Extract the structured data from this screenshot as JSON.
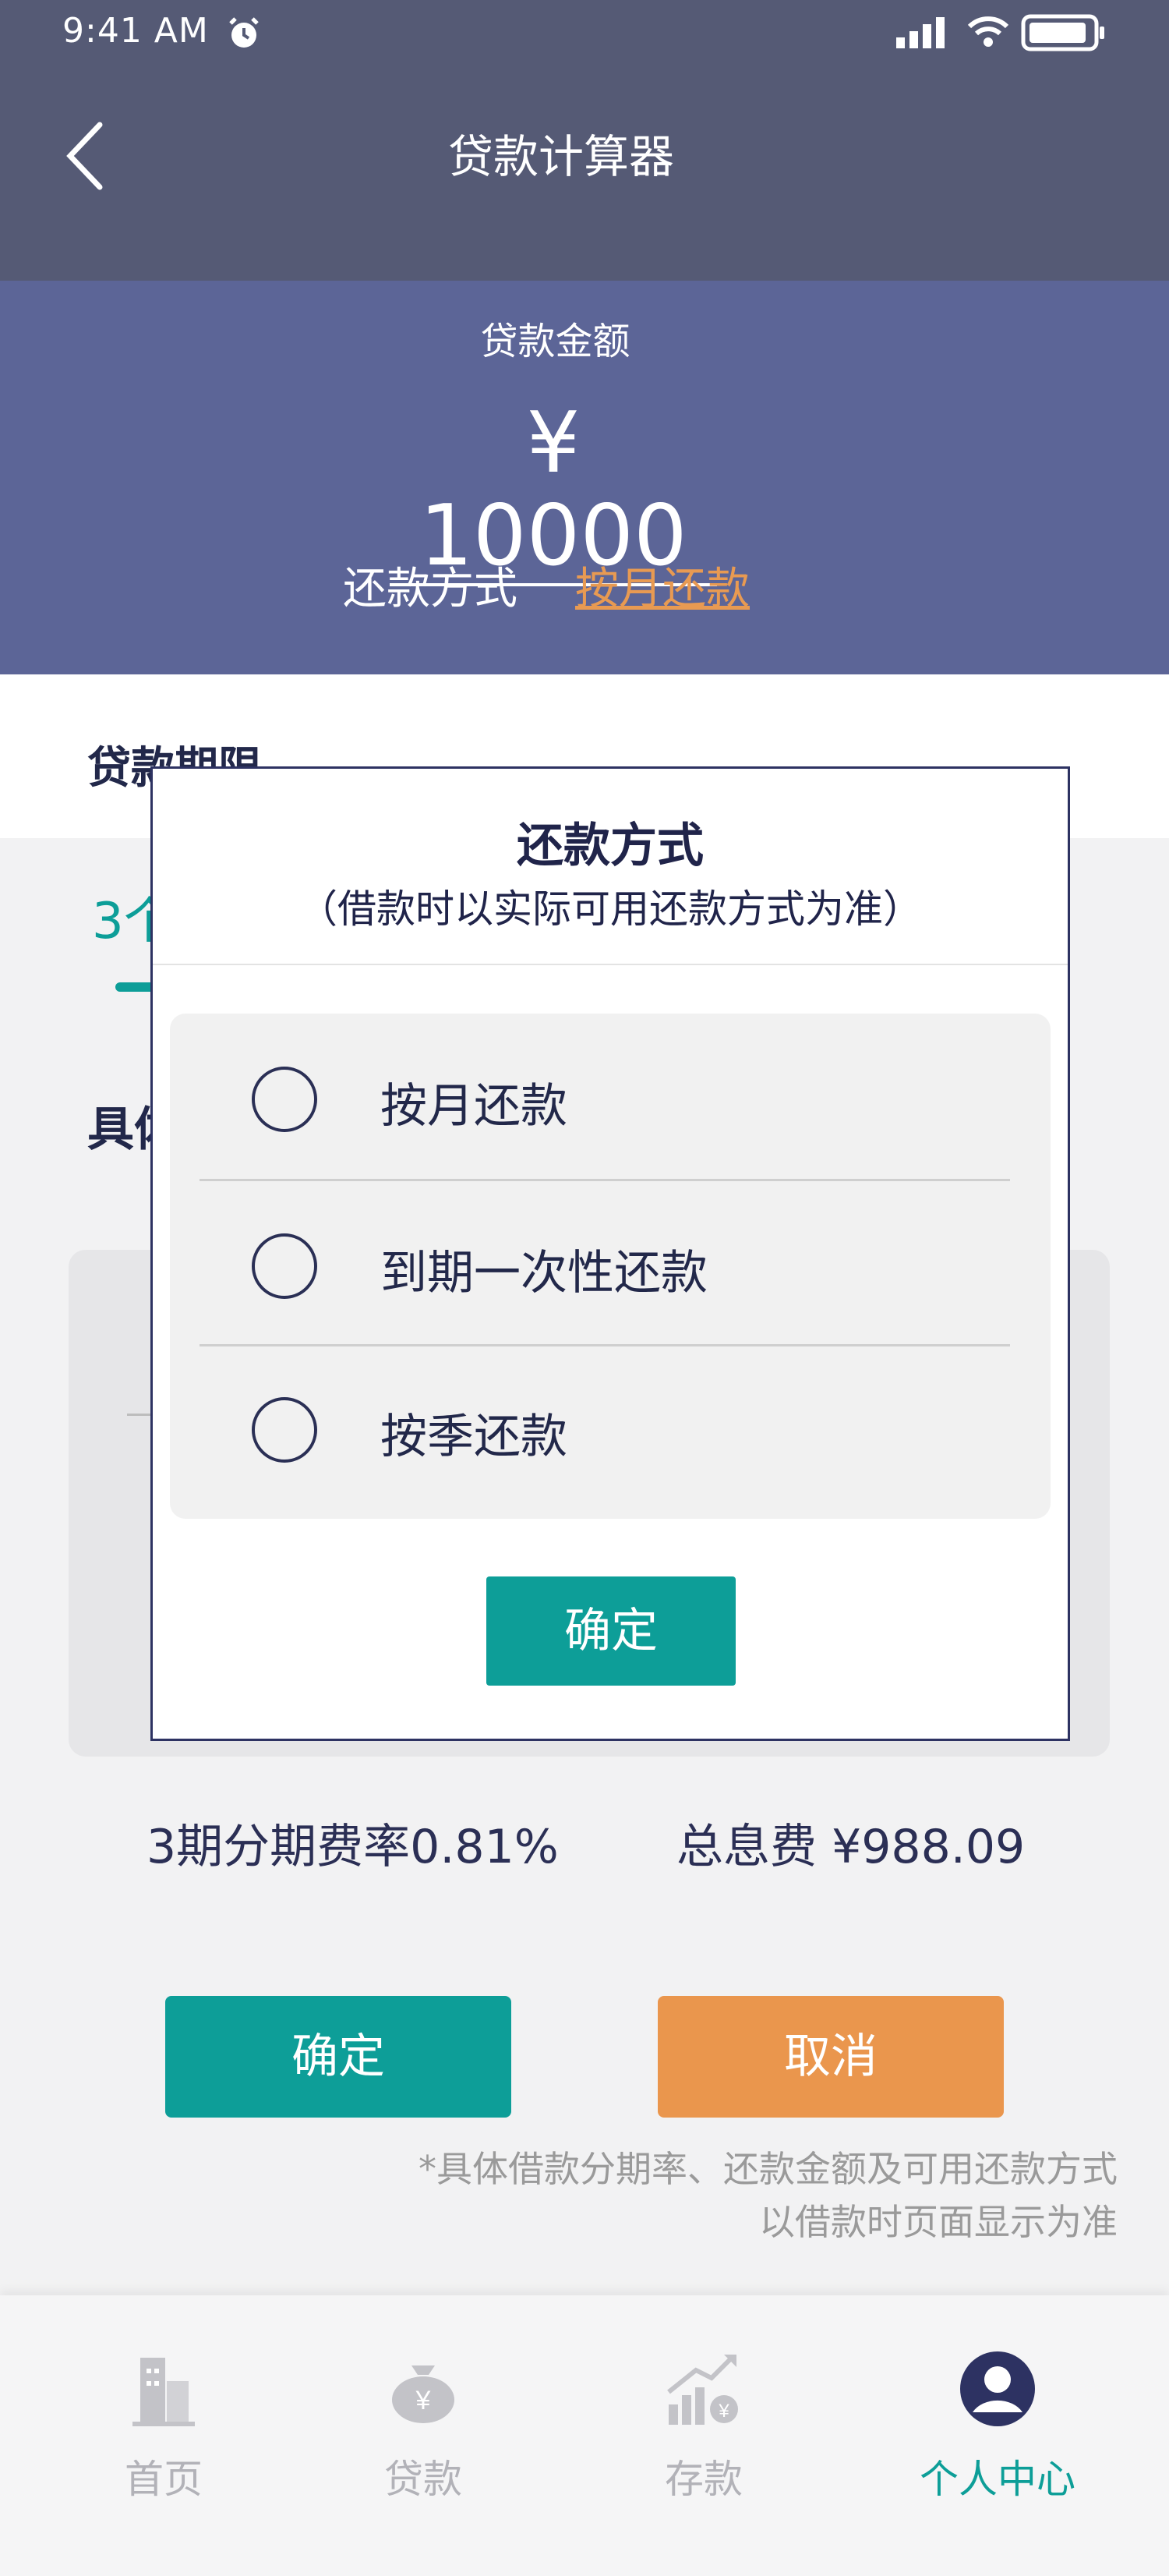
{
  "status_bar": {
    "time": "9:41 AM"
  },
  "nav": {
    "title": "贷款计算器"
  },
  "amount": {
    "label": "贷款金额",
    "value": "¥ 10000"
  },
  "repayment": {
    "label": "还款方式",
    "value": "按月还款"
  },
  "term": {
    "title": "贷款期限",
    "selected_tab": "3个"
  },
  "detail": {
    "title": "具体"
  },
  "summary": {
    "rate_text": "3期分期费率0.81%",
    "fee_text": "总息费 ¥988.09"
  },
  "actions": {
    "confirm": "确定",
    "cancel": "取消"
  },
  "disclaimer": {
    "line1": "*具体借款分期率、还款金额及可用还款方式",
    "line2": "以借款时页面显示为准"
  },
  "tabbar": {
    "items": [
      {
        "label": "首页",
        "icon": "building-icon",
        "active": false
      },
      {
        "label": "贷款",
        "icon": "money-bag-icon",
        "active": false
      },
      {
        "label": "存款",
        "icon": "growth-chart-icon",
        "active": false
      },
      {
        "label": "个人中心",
        "icon": "user-icon",
        "active": true
      }
    ]
  },
  "modal": {
    "title": "还款方式",
    "subtitle": "（借款时以实际可用还款方式为准）",
    "options": [
      {
        "label": "按月还款",
        "selected": false
      },
      {
        "label": "到期一次性还款",
        "selected": false
      },
      {
        "label": "按季还款",
        "selected": false
      }
    ],
    "ok": "确定"
  },
  "colors": {
    "header": "#555a75",
    "panel": "#5c6597",
    "teal": "#0d9e98",
    "orange": "#ea964d"
  }
}
